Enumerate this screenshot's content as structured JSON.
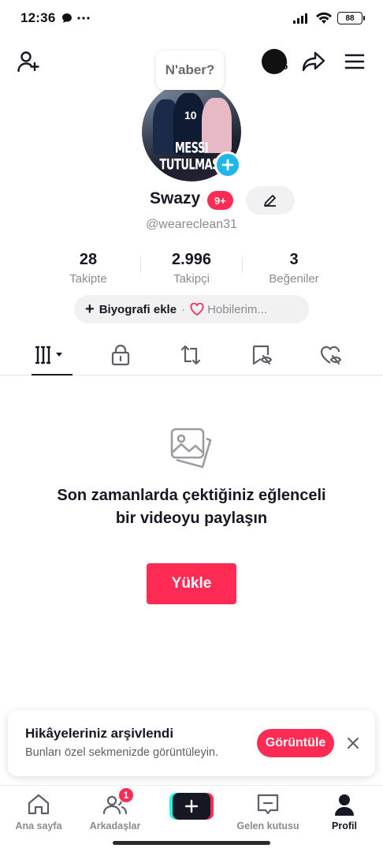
{
  "status_bar": {
    "time": "12:36",
    "left_icons": [
      "message-bubble-icon",
      "more-dots-icon"
    ],
    "right_icons": [
      "signal-icon",
      "wifi-icon",
      "battery-icon"
    ],
    "battery": "88"
  },
  "header": {
    "add_user_icon": "add-user-icon",
    "coins": "5",
    "share_icon": "share-icon",
    "menu_icon": "hamburger-menu-icon",
    "note_bubble": "N'aber?"
  },
  "profile": {
    "avatar_text": "MESSI TUTULMAS!",
    "name": "Swazy",
    "notification_badge": "9+",
    "handle": "@weareclean31"
  },
  "stats": [
    {
      "value": "28",
      "label": "Takipte"
    },
    {
      "value": "2.996",
      "label": "Takipçi"
    },
    {
      "value": "3",
      "label": "Beğeniler"
    }
  ],
  "bio": {
    "add_label": "Biyografi ekle",
    "separator": "·",
    "hobbies_label": "Hobilerim..."
  },
  "tabs": [
    {
      "name": "videos",
      "icon": "grid-icon",
      "active": true
    },
    {
      "name": "private",
      "icon": "lock-icon",
      "active": false
    },
    {
      "name": "reposts",
      "icon": "repost-icon",
      "active": false
    },
    {
      "name": "favorites",
      "icon": "bookmark-icon",
      "active": false
    },
    {
      "name": "liked",
      "icon": "liked-hidden-icon",
      "active": false
    }
  ],
  "empty_state": {
    "title": "Son zamanlarda çektiğiniz eğlenceli bir videoyu paylaşın",
    "button": "Yükle"
  },
  "toast": {
    "title": "Hikâyeleriniz arşivlendi",
    "subtitle": "Bunları özel sekmenizde görüntüleyin.",
    "button": "Görüntüle"
  },
  "bottom_nav": [
    {
      "label": "Ana sayfa",
      "icon": "home-icon"
    },
    {
      "label": "Arkadaşlar",
      "icon": "friends-icon",
      "badge": "1"
    },
    {
      "label": "",
      "icon": "create-icon"
    },
    {
      "label": "Gelen kutusu",
      "icon": "inbox-icon"
    },
    {
      "label": "Profil",
      "icon": "profile-icon",
      "active": true
    }
  ],
  "colors": {
    "accent": "#fe2c55",
    "avatar_add": "#20b6e8",
    "text_primary": "#161823",
    "text_secondary": "#8a8b91"
  }
}
